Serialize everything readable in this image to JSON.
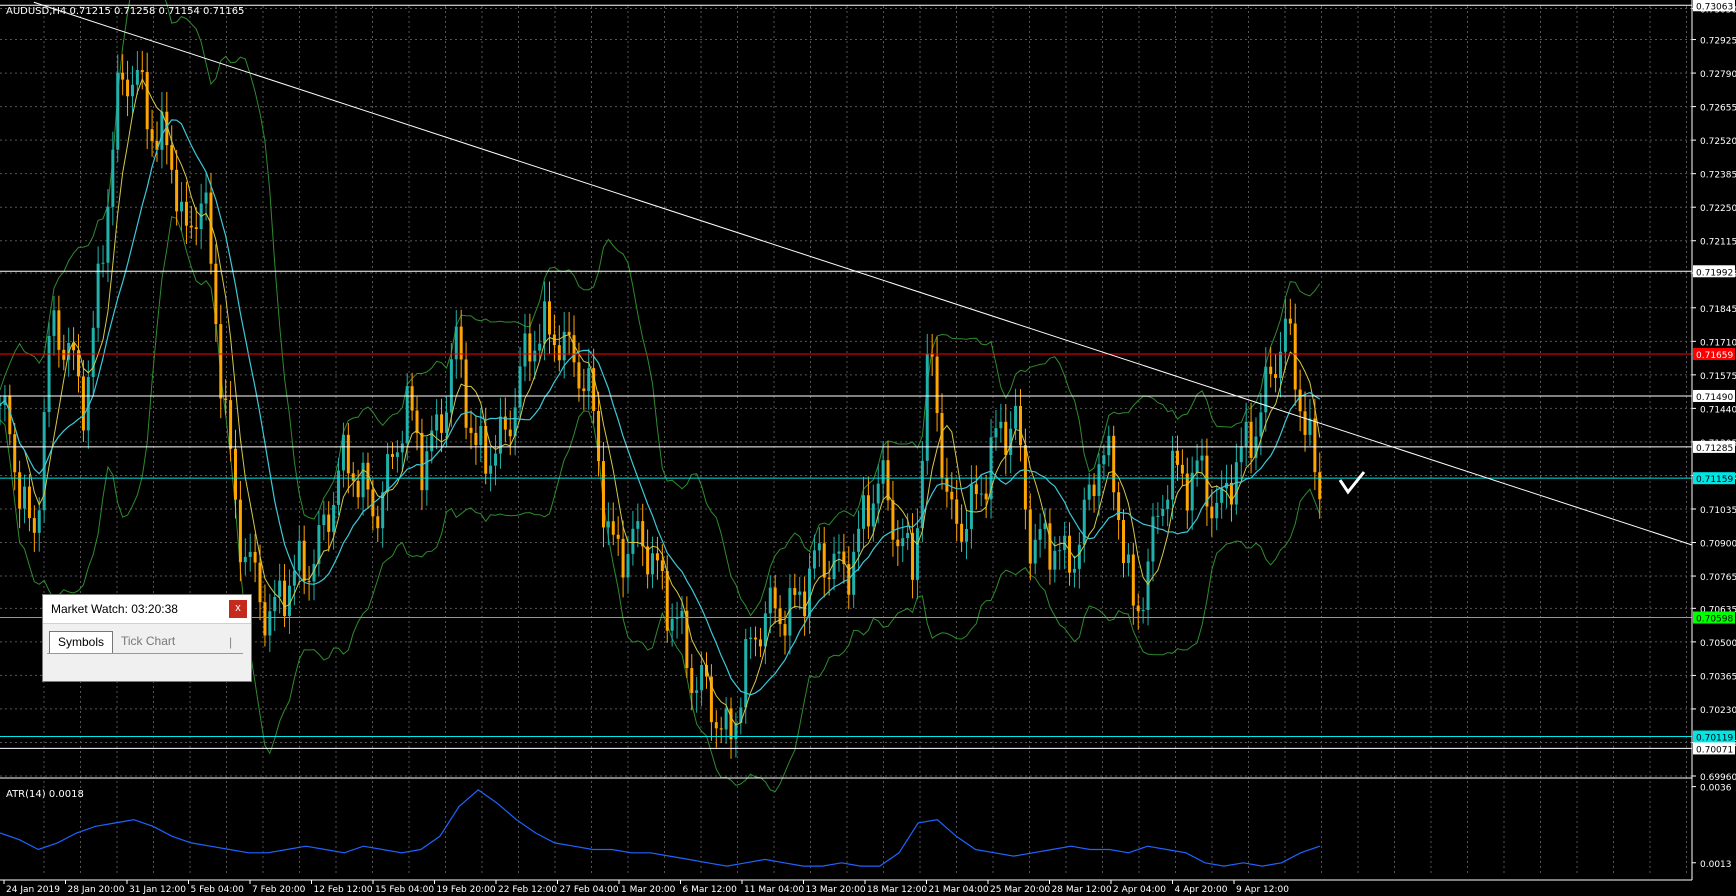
{
  "chart_data": [
    {
      "type": "line",
      "title": "AUDUSD,H4  0.71215 0.71258 0.71154 0.71165",
      "y_ticks": [
        "0.73050",
        "0.72925",
        "0.72790",
        "0.72655",
        "0.72520",
        "0.72385",
        "0.72250",
        "0.72115",
        "0.71985",
        "0.71845",
        "0.71710",
        "0.71575",
        "0.71440",
        "0.71305",
        "0.71170",
        "0.71035",
        "0.70900",
        "0.70765",
        "0.70635",
        "0.70500",
        "0.70365",
        "0.70230",
        "0.70095",
        "0.69960"
      ],
      "ylim": [
        0.6996,
        0.7306
      ],
      "price_labels": [
        {
          "text": "0.73063",
          "value": 0.73063,
          "bg": "#ffffff",
          "fg": "#000000"
        },
        {
          "text": "0.71992",
          "value": 0.71992,
          "bg": "#ffffff",
          "fg": "#000000"
        },
        {
          "text": "0.71659",
          "value": 0.71659,
          "bg": "#ff0000",
          "fg": "#ffffff"
        },
        {
          "text": "0.71490",
          "value": 0.7149,
          "bg": "#ffffff",
          "fg": "#000000"
        },
        {
          "text": "0.71285",
          "value": 0.71285,
          "bg": "#ffffff",
          "fg": "#000000"
        },
        {
          "text": "0.71159",
          "value": 0.71159,
          "bg": "#00e5e5",
          "fg": "#000000"
        },
        {
          "text": "0.70598",
          "value": 0.70598,
          "bg": "#00ff00",
          "fg": "#000000"
        },
        {
          "text": "0.70119",
          "value": 0.70119,
          "bg": "#00e5e5",
          "fg": "#000000"
        },
        {
          "text": "0.70071",
          "value": 0.70071,
          "bg": "#ffffff",
          "fg": "#000000"
        }
      ],
      "hlines": [
        {
          "value": 0.73063,
          "color": "#ffffff"
        },
        {
          "value": 0.71992,
          "color": "#ffffff"
        },
        {
          "value": 0.71659,
          "color": "#ff0000"
        },
        {
          "value": 0.7149,
          "color": "#ffffff"
        },
        {
          "value": 0.71285,
          "color": "#ffffff"
        },
        {
          "value": 0.71159,
          "color": "#00e5e5"
        },
        {
          "value": 0.70598,
          "color": "#00ff00"
        },
        {
          "value": 0.70119,
          "color": "#00e5e5"
        },
        {
          "value": 0.70071,
          "color": "#ffffff"
        }
      ],
      "trendline": {
        "color": "#ffffff",
        "from": {
          "x": 0.02,
          "y": 0.73075
        },
        "to": {
          "x": 1.0,
          "y": 0.7089
        }
      },
      "close_anchors": [
        [
          0.0,
          0.714
        ],
        [
          0.02,
          0.7095
        ],
        [
          0.03,
          0.7175
        ],
        [
          0.05,
          0.715
        ],
        [
          0.07,
          0.7265
        ],
        [
          0.08,
          0.728
        ],
        [
          0.1,
          0.7245
        ],
        [
          0.11,
          0.7205
        ],
        [
          0.12,
          0.724
        ],
        [
          0.14,
          0.709
        ],
        [
          0.16,
          0.7065
        ],
        [
          0.18,
          0.7075
        ],
        [
          0.2,
          0.712
        ],
        [
          0.22,
          0.7105
        ],
        [
          0.24,
          0.714
        ],
        [
          0.25,
          0.712
        ],
        [
          0.27,
          0.717
        ],
        [
          0.28,
          0.712
        ],
        [
          0.3,
          0.714
        ],
        [
          0.32,
          0.7175
        ],
        [
          0.33,
          0.718
        ],
        [
          0.35,
          0.714
        ],
        [
          0.36,
          0.7095
        ],
        [
          0.38,
          0.7085
        ],
        [
          0.4,
          0.7065
        ],
        [
          0.41,
          0.703
        ],
        [
          0.43,
          0.7015
        ],
        [
          0.44,
          0.704
        ],
        [
          0.46,
          0.7065
        ],
        [
          0.48,
          0.7075
        ],
        [
          0.5,
          0.7085
        ],
        [
          0.52,
          0.711
        ],
        [
          0.54,
          0.7085
        ],
        [
          0.55,
          0.7165
        ],
        [
          0.56,
          0.71
        ],
        [
          0.58,
          0.711
        ],
        [
          0.6,
          0.7145
        ],
        [
          0.61,
          0.709
        ],
        [
          0.63,
          0.708
        ],
        [
          0.65,
          0.7125
        ],
        [
          0.66,
          0.7105
        ],
        [
          0.67,
          0.7065
        ],
        [
          0.69,
          0.711
        ],
        [
          0.71,
          0.7125
        ],
        [
          0.72,
          0.7095
        ],
        [
          0.74,
          0.714
        ],
        [
          0.76,
          0.717
        ],
        [
          0.77,
          0.7145
        ],
        [
          0.78,
          0.7116
        ]
      ],
      "x_ticks": [
        "24 Jan 2019",
        "28 Jan 20:00",
        "31 Jan 12:00",
        "5 Feb 04:00",
        "7 Feb 20:00",
        "12 Feb 12:00",
        "15 Feb 04:00",
        "19 Feb 20:00",
        "22 Feb 12:00",
        "27 Feb 04:00",
        "1 Mar 20:00",
        "6 Mar 12:00",
        "11 Mar 04:00",
        "13 Mar 20:00",
        "18 Mar 12:00",
        "21 Mar 04:00",
        "25 Mar 20:00",
        "28 Mar 12:00",
        "2 Apr 04:00",
        "4 Apr 20:00",
        "9 Apr 12:00"
      ],
      "colors": {
        "bull": "#20b2aa",
        "bear": "#ffa500",
        "grid": "#555555",
        "axis": "#ffffff",
        "ma_fast": "#d4c84a",
        "ma_slow": "#3cc8d8",
        "bands": "#2e8b2e"
      }
    },
    {
      "type": "line",
      "title": "ATR(14) 0.0018",
      "y_ticks": [
        "0.0036",
        "0.0013"
      ],
      "ylim": [
        0.0009,
        0.0038
      ],
      "series": [
        {
          "color": "#1e64ff",
          "values": [
            0.0022,
            0.002,
            0.0017,
            0.0019,
            0.0022,
            0.0024,
            0.0025,
            0.0026,
            0.0024,
            0.0021,
            0.0019,
            0.0018,
            0.0017,
            0.0016,
            0.0016,
            0.0017,
            0.0018,
            0.0017,
            0.0016,
            0.0018,
            0.0017,
            0.0016,
            0.0017,
            0.0021,
            0.003,
            0.0035,
            0.0031,
            0.0026,
            0.0022,
            0.0019,
            0.0018,
            0.0017,
            0.0017,
            0.0016,
            0.0016,
            0.0015,
            0.0014,
            0.0013,
            0.0012,
            0.0013,
            0.0014,
            0.0013,
            0.0012,
            0.0012,
            0.0013,
            0.0012,
            0.0012,
            0.0016,
            0.0025,
            0.0026,
            0.0021,
            0.0017,
            0.0016,
            0.0015,
            0.0016,
            0.0017,
            0.0018,
            0.0017,
            0.0017,
            0.0016,
            0.0018,
            0.0017,
            0.0016,
            0.0013,
            0.0012,
            0.0013,
            0.0012,
            0.0013,
            0.0016,
            0.0018
          ]
        }
      ]
    }
  ],
  "market_watch": {
    "title": "Market Watch: 03:20:38",
    "close": "x",
    "tab_symbols": "Symbols",
    "tab_tick": "Tick Chart",
    "sep": "|"
  }
}
